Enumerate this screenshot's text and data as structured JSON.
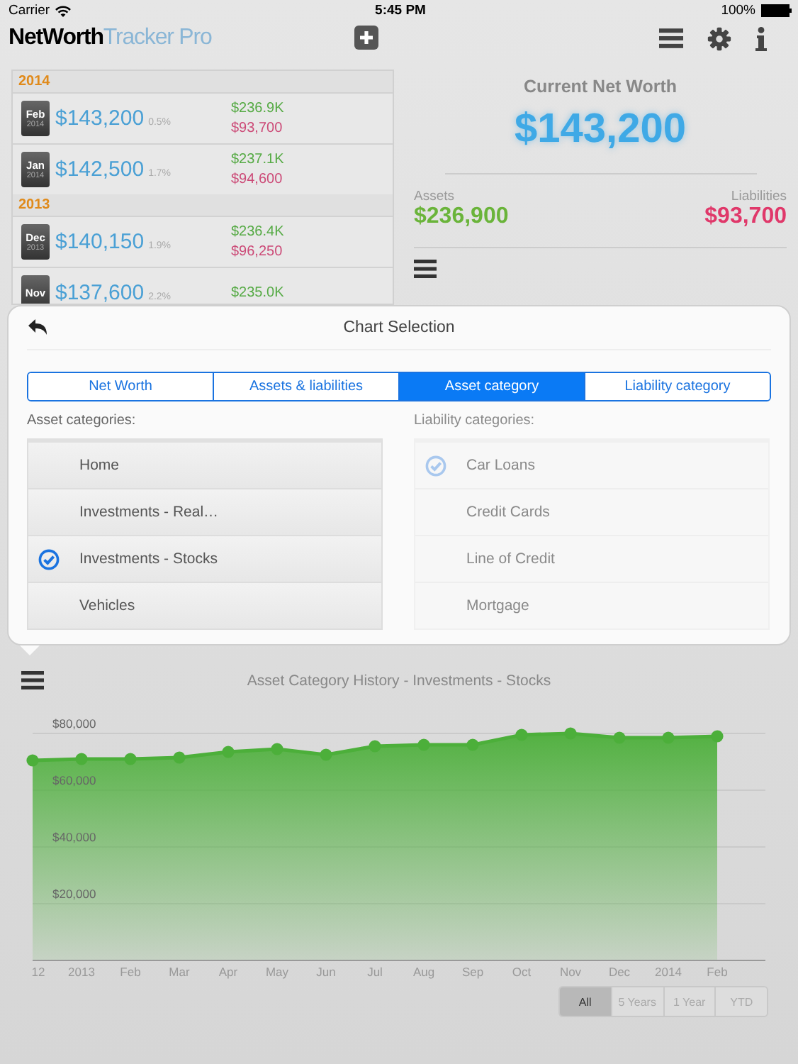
{
  "status_bar": {
    "carrier": "Carrier",
    "time": "5:45 PM",
    "battery": "100%"
  },
  "app_bar": {
    "title": "NetWorth",
    "subtitle": "Tracker Pro"
  },
  "history": [
    {
      "year": "2014",
      "entries": [
        {
          "month": "Feb",
          "year": "2014",
          "net_worth": "$143,200",
          "change": "0.5%",
          "assets": "$236.9K",
          "liabilities": "$93,700"
        },
        {
          "month": "Jan",
          "year": "2014",
          "net_worth": "$142,500",
          "change": "1.7%",
          "assets": "$237.1K",
          "liabilities": "$94,600"
        }
      ]
    },
    {
      "year": "2013",
      "entries": [
        {
          "month": "Dec",
          "year": "2013",
          "net_worth": "$140,150",
          "change": "1.9%",
          "assets": "$236.4K",
          "liabilities": "$96,250"
        },
        {
          "month": "Nov",
          "net_worth": "$137,600",
          "change": "2.2%",
          "assets": "$235.0K"
        }
      ]
    }
  ],
  "summary": {
    "label": "Current Net Worth",
    "net_worth": "$143,200",
    "assets_label": "Assets",
    "assets": "$236,900",
    "liabilities_label": "Liabilities",
    "liabilities": "$93,700"
  },
  "chart_selection": {
    "title": "Chart Selection",
    "tabs": [
      {
        "label": "Net Worth",
        "selected": false
      },
      {
        "label": "Assets & liabilities",
        "selected": false
      },
      {
        "label": "Asset category",
        "selected": true
      },
      {
        "label": "Liability category",
        "selected": false
      }
    ],
    "asset_categories": {
      "label": "Asset categories:",
      "disabled": false,
      "items": [
        {
          "label": "Home",
          "selected": false
        },
        {
          "label": "Investments - Real…",
          "selected": false
        },
        {
          "label": "Investments - Stocks",
          "selected": true
        },
        {
          "label": "Vehicles",
          "selected": false
        }
      ]
    },
    "liability_categories": {
      "label": "Liability categories:",
      "disabled": true,
      "items": [
        {
          "label": "Car Loans",
          "selected": true
        },
        {
          "label": "Credit Cards",
          "selected": false
        },
        {
          "label": "Line of Credit",
          "selected": false
        },
        {
          "label": "Mortgage",
          "selected": false
        }
      ]
    }
  },
  "chart": {
    "chart_data": {
      "type": "area",
      "title": "Asset Category History - Investments - Stocks",
      "categories": [
        "12",
        "2013",
        "Feb",
        "Mar",
        "Apr",
        "May",
        "Jun",
        "Jul",
        "Aug",
        "Sep",
        "Oct",
        "Nov",
        "Dec",
        "2014",
        "Feb"
      ],
      "series": [
        {
          "color": "#4caf3a",
          "values": [
            70500,
            71000,
            71000,
            71500,
            73500,
            74500,
            72500,
            75500,
            76000,
            76000,
            79500,
            80000,
            78500,
            78500,
            79000
          ]
        }
      ],
      "ylim": [
        0,
        80000
      ],
      "grid": true,
      "yticks": [
        {
          "value": 20000,
          "label": "$20,000"
        },
        {
          "value": 40000,
          "label": "$40,000"
        },
        {
          "value": 60000,
          "label": "$60,000"
        },
        {
          "value": 80000,
          "label": "$80,000"
        }
      ]
    },
    "ranges": [
      {
        "label": "All",
        "selected": true
      },
      {
        "label": "5 Years",
        "selected": false
      },
      {
        "label": "1 Year",
        "selected": false
      },
      {
        "label": "YTD",
        "selected": false
      }
    ]
  }
}
